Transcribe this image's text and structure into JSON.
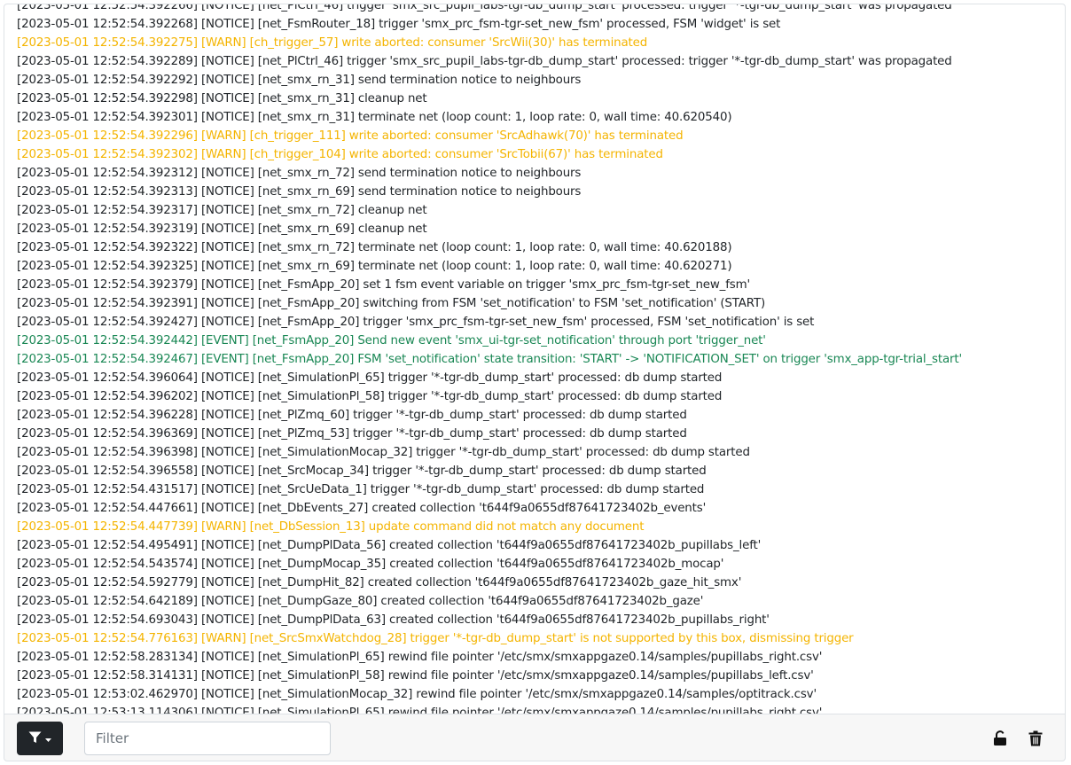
{
  "log": {
    "lines": [
      {
        "text": "[2023-05-01 12:52:54.392266] [NOTICE] [net_PlCtrl_46] trigger 'smx_src_pupil_labs-tgr-db_dump_start' processed: trigger '*-tgr-db_dump_start' was propagated",
        "level": "notice"
      },
      {
        "text": "[2023-05-01 12:52:54.392268] [NOTICE] [net_FsmRouter_18] trigger 'smx_prc_fsm-tgr-set_new_fsm' processed, FSM 'widget' is set",
        "level": "notice"
      },
      {
        "text": "[2023-05-01 12:52:54.392275] [WARN] [ch_trigger_57] write aborted: consumer 'SrcWii(30)' has terminated",
        "level": "warn"
      },
      {
        "text": "[2023-05-01 12:52:54.392289] [NOTICE] [net_PlCtrl_46] trigger 'smx_src_pupil_labs-tgr-db_dump_start' processed: trigger '*-tgr-db_dump_start' was propagated",
        "level": "notice"
      },
      {
        "text": "[2023-05-01 12:52:54.392292] [NOTICE] [net_smx_rn_31] send termination notice to neighbours",
        "level": "notice"
      },
      {
        "text": "[2023-05-01 12:52:54.392298] [NOTICE] [net_smx_rn_31] cleanup net",
        "level": "notice"
      },
      {
        "text": "[2023-05-01 12:52:54.392301] [NOTICE] [net_smx_rn_31] terminate net (loop count: 1, loop rate: 0, wall time: 40.620540)",
        "level": "notice"
      },
      {
        "text": "[2023-05-01 12:52:54.392296] [WARN] [ch_trigger_111] write aborted: consumer 'SrcAdhawk(70)' has terminated",
        "level": "warn"
      },
      {
        "text": "[2023-05-01 12:52:54.392302] [WARN] [ch_trigger_104] write aborted: consumer 'SrcTobii(67)' has terminated",
        "level": "warn"
      },
      {
        "text": "[2023-05-01 12:52:54.392312] [NOTICE] [net_smx_rn_72] send termination notice to neighbours",
        "level": "notice"
      },
      {
        "text": "[2023-05-01 12:52:54.392313] [NOTICE] [net_smx_rn_69] send termination notice to neighbours",
        "level": "notice"
      },
      {
        "text": "[2023-05-01 12:52:54.392317] [NOTICE] [net_smx_rn_72] cleanup net",
        "level": "notice"
      },
      {
        "text": "[2023-05-01 12:52:54.392319] [NOTICE] [net_smx_rn_69] cleanup net",
        "level": "notice"
      },
      {
        "text": "[2023-05-01 12:52:54.392322] [NOTICE] [net_smx_rn_72] terminate net (loop count: 1, loop rate: 0, wall time: 40.620188)",
        "level": "notice"
      },
      {
        "text": "[2023-05-01 12:52:54.392325] [NOTICE] [net_smx_rn_69] terminate net (loop count: 1, loop rate: 0, wall time: 40.620271)",
        "level": "notice"
      },
      {
        "text": "[2023-05-01 12:52:54.392379] [NOTICE] [net_FsmApp_20] set 1 fsm event variable on trigger 'smx_prc_fsm-tgr-set_new_fsm'",
        "level": "notice"
      },
      {
        "text": "[2023-05-01 12:52:54.392391] [NOTICE] [net_FsmApp_20] switching from FSM 'set_notification' to FSM 'set_notification' (START)",
        "level": "notice"
      },
      {
        "text": "[2023-05-01 12:52:54.392427] [NOTICE] [net_FsmApp_20] trigger 'smx_prc_fsm-tgr-set_new_fsm' processed, FSM 'set_notification' is set",
        "level": "notice"
      },
      {
        "text": "[2023-05-01 12:52:54.392442] [EVENT] [net_FsmApp_20] Send new event 'smx_ui-tgr-set_notification' through port 'trigger_net'",
        "level": "event"
      },
      {
        "text": "[2023-05-01 12:52:54.392467] [EVENT] [net_FsmApp_20] FSM 'set_notification' state transition: 'START' -> 'NOTIFICATION_SET' on trigger 'smx_app-tgr-trial_start'",
        "level": "event"
      },
      {
        "text": "[2023-05-01 12:52:54.396064] [NOTICE] [net_SimulationPl_65] trigger '*-tgr-db_dump_start' processed: db dump started",
        "level": "notice"
      },
      {
        "text": "[2023-05-01 12:52:54.396202] [NOTICE] [net_SimulationPl_58] trigger '*-tgr-db_dump_start' processed: db dump started",
        "level": "notice"
      },
      {
        "text": "[2023-05-01 12:52:54.396228] [NOTICE] [net_PlZmq_60] trigger '*-tgr-db_dump_start' processed: db dump started",
        "level": "notice"
      },
      {
        "text": "[2023-05-01 12:52:54.396369] [NOTICE] [net_PlZmq_53] trigger '*-tgr-db_dump_start' processed: db dump started",
        "level": "notice"
      },
      {
        "text": "[2023-05-01 12:52:54.396398] [NOTICE] [net_SimulationMocap_32] trigger '*-tgr-db_dump_start' processed: db dump started",
        "level": "notice"
      },
      {
        "text": "[2023-05-01 12:52:54.396558] [NOTICE] [net_SrcMocap_34] trigger '*-tgr-db_dump_start' processed: db dump started",
        "level": "notice"
      },
      {
        "text": "[2023-05-01 12:52:54.431517] [NOTICE] [net_SrcUeData_1] trigger '*-tgr-db_dump_start' processed: db dump started",
        "level": "notice"
      },
      {
        "text": "[2023-05-01 12:52:54.447661] [NOTICE] [net_DbEvents_27] created collection 't644f9a0655df87641723402b_events'",
        "level": "notice"
      },
      {
        "text": "[2023-05-01 12:52:54.447739] [WARN] [net_DbSession_13] update command did not match any document",
        "level": "warn"
      },
      {
        "text": "[2023-05-01 12:52:54.495491] [NOTICE] [net_DumpPlData_56] created collection 't644f9a0655df87641723402b_pupillabs_left'",
        "level": "notice"
      },
      {
        "text": "[2023-05-01 12:52:54.543574] [NOTICE] [net_DumpMocap_35] created collection 't644f9a0655df87641723402b_mocap'",
        "level": "notice"
      },
      {
        "text": "[2023-05-01 12:52:54.592779] [NOTICE] [net_DumpHit_82] created collection 't644f9a0655df87641723402b_gaze_hit_smx'",
        "level": "notice"
      },
      {
        "text": "[2023-05-01 12:52:54.642189] [NOTICE] [net_DumpGaze_80] created collection 't644f9a0655df87641723402b_gaze'",
        "level": "notice"
      },
      {
        "text": "[2023-05-01 12:52:54.693043] [NOTICE] [net_DumpPlData_63] created collection 't644f9a0655df87641723402b_pupillabs_right'",
        "level": "notice"
      },
      {
        "text": "[2023-05-01 12:52:54.776163] [WARN] [net_SrcSmxWatchdog_28] trigger '*-tgr-db_dump_start' is not supported by this box, dismissing trigger",
        "level": "warn"
      },
      {
        "text": "[2023-05-01 12:52:58.283134] [NOTICE] [net_SimulationPl_65] rewind file pointer '/etc/smx/smxappgaze0.14/samples/pupillabs_right.csv'",
        "level": "notice"
      },
      {
        "text": "[2023-05-01 12:52:58.314131] [NOTICE] [net_SimulationPl_58] rewind file pointer '/etc/smx/smxappgaze0.14/samples/pupillabs_left.csv'",
        "level": "notice"
      },
      {
        "text": "[2023-05-01 12:53:02.462970] [NOTICE] [net_SimulationMocap_32] rewind file pointer '/etc/smx/smxappgaze0.14/samples/optitrack.csv'",
        "level": "notice"
      },
      {
        "text": "[2023-05-01 12:53:13.114306] [NOTICE] [net_SimulationPl_65] rewind file pointer '/etc/smx/smxappgaze0.14/samples/pupillabs_right.csv'",
        "level": "notice"
      }
    ]
  },
  "footer": {
    "filter_button_icons": [
      "filter-icon",
      "caret-down-icon"
    ],
    "filter_placeholder": "Filter",
    "filter_value": "",
    "lock_icon": "unlock-icon",
    "trash_icon": "trash-icon"
  },
  "colors": {
    "notice": "#212529",
    "warn": "#f4b400",
    "event": "#198754",
    "button_dark": "#212529"
  }
}
